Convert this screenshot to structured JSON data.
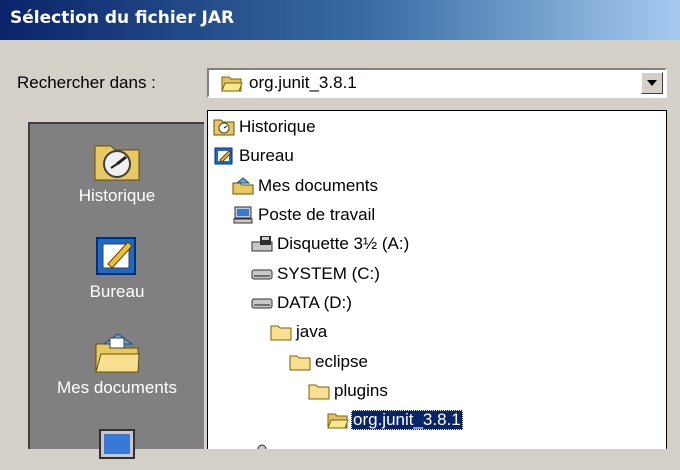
{
  "window": {
    "title": "Sélection du fichier JAR"
  },
  "lookin": {
    "label": "Rechercher dans :",
    "current": "org.junit_3.8.1"
  },
  "places": [
    {
      "label": "Historique",
      "icon": "history-icon"
    },
    {
      "label": "Bureau",
      "icon": "desktop-icon"
    },
    {
      "label": "Mes documents",
      "icon": "my-documents-icon"
    },
    {
      "label": "",
      "icon": "my-computer-icon"
    }
  ],
  "dropdown": {
    "items": [
      {
        "label": "Historique",
        "icon": "history-icon"
      },
      {
        "label": "Bureau",
        "icon": "desktop-icon"
      },
      {
        "label": "Mes documents",
        "icon": "my-documents-icon"
      },
      {
        "label": "Poste de travail",
        "icon": "my-computer-icon"
      },
      {
        "label": "Disquette 3½ (A:)",
        "icon": "floppy-drive-icon"
      },
      {
        "label": "SYSTEM (C:)",
        "icon": "hard-drive-icon"
      },
      {
        "label": "DATA (D:)",
        "icon": "hard-drive-icon"
      },
      {
        "label": "java",
        "icon": "folder-icon"
      },
      {
        "label": "eclipse",
        "icon": "folder-icon"
      },
      {
        "label": "plugins",
        "icon": "folder-icon"
      },
      {
        "label": "org.junit_3.8.1",
        "icon": "open-folder-icon",
        "selected": true
      }
    ]
  },
  "colors": {
    "titlebar": "#0a246a",
    "selection": "#0a246a",
    "dialog": "#d4d0c8",
    "places_bar": "#808080"
  }
}
